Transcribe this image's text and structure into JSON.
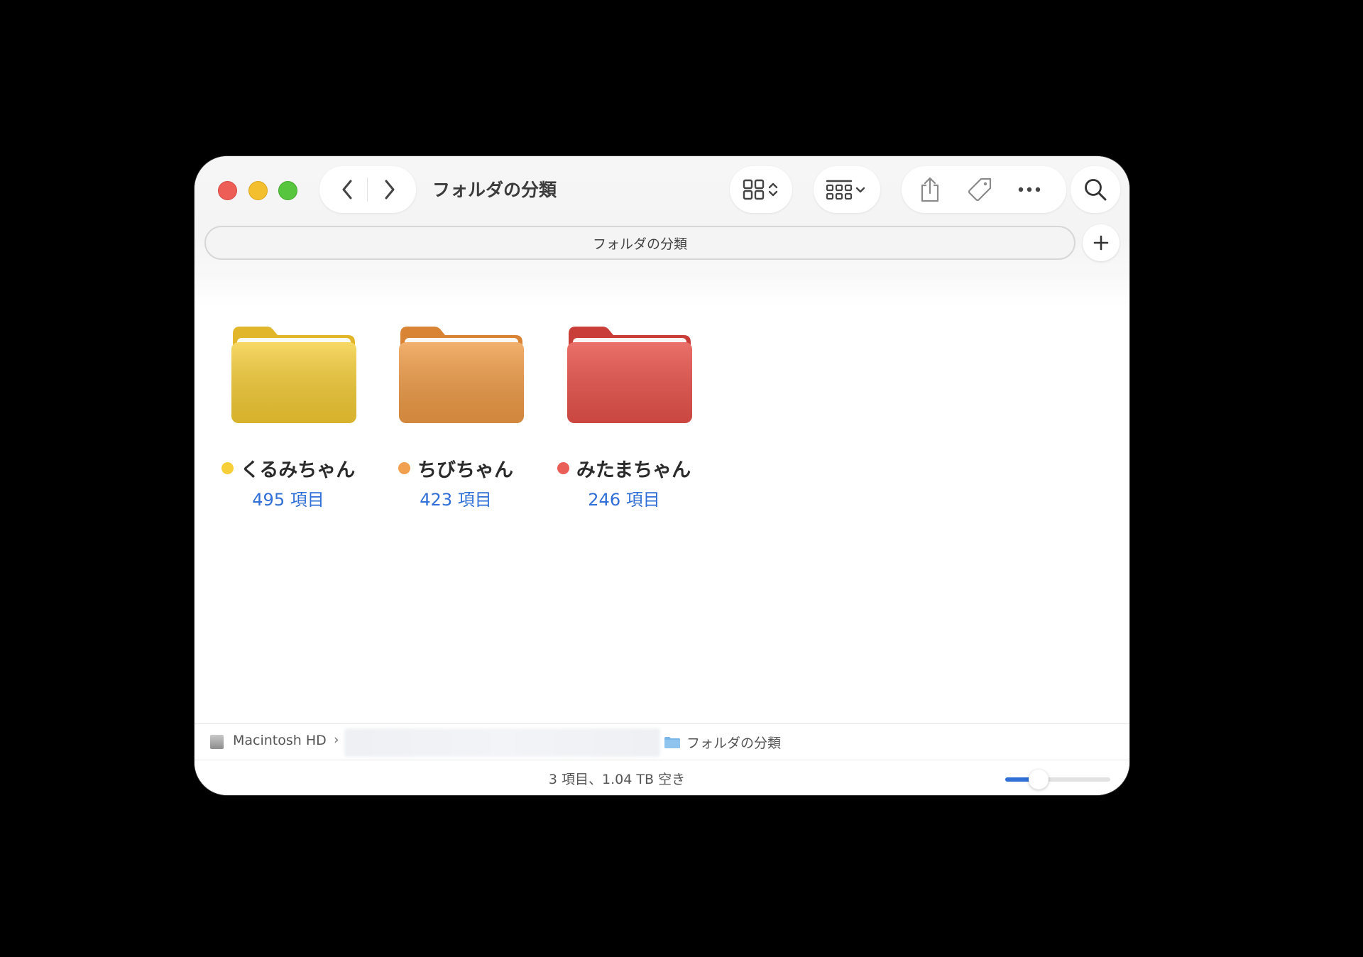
{
  "window": {
    "title": "フォルダの分類"
  },
  "toolbar": {
    "back_icon": "chevron-left-icon",
    "forward_icon": "chevron-right-icon",
    "view_icon": "grid-view-icon",
    "group_icon": "group-icon",
    "share_icon": "share-icon",
    "tag_icon": "tag-icon",
    "more_icon": "ellipsis-icon",
    "search_icon": "search-icon"
  },
  "tabbar": {
    "active_tab": "フォルダの分類",
    "new_tab_icon": "plus-icon"
  },
  "folders": [
    {
      "name": "くるみちゃん",
      "count": "495 項目",
      "tag_color": "#f7cf38",
      "folder_color": "#f5cc33"
    },
    {
      "name": "ちびちゃん",
      "count": "423 項目",
      "tag_color": "#f0a04f",
      "folder_color": "#ee9a45"
    },
    {
      "name": "みたまちゃん",
      "count": "246 項目",
      "tag_color": "#ea5e58",
      "folder_color": "#e6514a"
    }
  ],
  "pathbar": {
    "disk": "Macintosh HD",
    "separator": "›",
    "current": "フォルダの分類"
  },
  "statusbar": {
    "text": "3 項目、1.04 TB 空き",
    "icon_size_fraction": 0.32
  },
  "colors": {
    "accent": "#2f6fd6"
  }
}
